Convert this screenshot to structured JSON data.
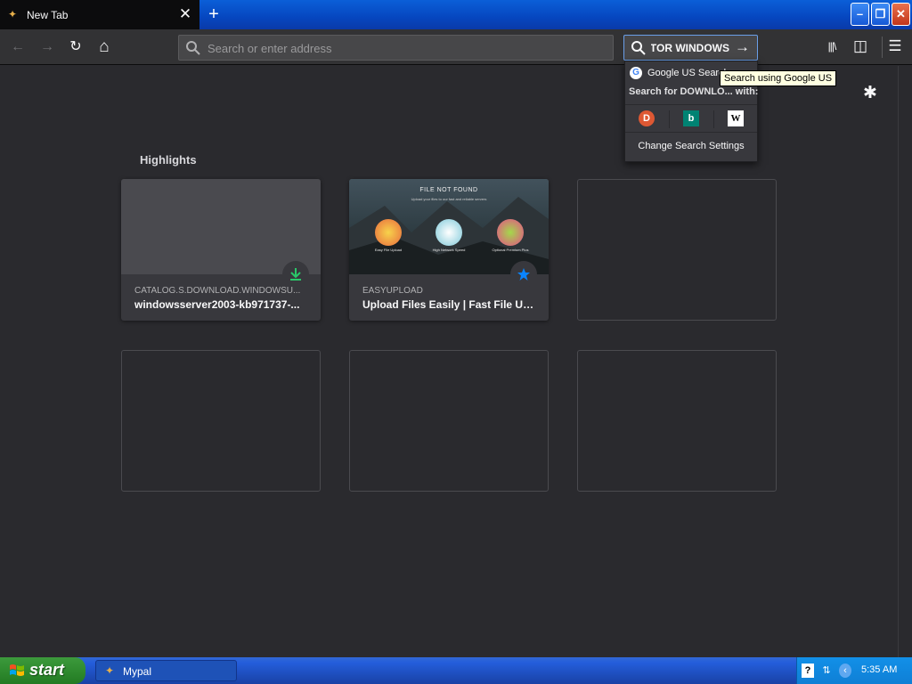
{
  "window": {
    "tab_title": "New Tab",
    "tab_close": "✕",
    "new_tab": "+",
    "minimize": "–",
    "maximize": "❐",
    "close": "✕"
  },
  "navbar": {
    "back": "←",
    "forward": "→",
    "reload": "↻",
    "home": "⌂",
    "url_placeholder": "Search or enter address",
    "search_value": "TOR WINDOWS",
    "search_go": "→",
    "library": "|||\\",
    "sidebar": "◫",
    "menu": "☰"
  },
  "content": {
    "settings_icon": "✱",
    "section_title": "Highlights",
    "highlights": [
      {
        "host": "CATALOG.S.DOWNLOAD.WINDOWSU...",
        "title": "windowsserver2003-kb971737-...",
        "badge": "download-icon"
      },
      {
        "host": "EASYUPLOAD",
        "title": "Upload Files Easily | Fast File Upl...",
        "badge": "bookmark-star-icon"
      }
    ],
    "thumbnail": {
      "heading": "FILE NOT FOUND",
      "sub": "Upload your files to our fast and reliable servers",
      "features": [
        "Easy File Upload",
        "High Network Speed",
        "Optional Premium Plus"
      ]
    }
  },
  "search_popup": {
    "engine_name": "Google US Search",
    "search_for": "Search for DOWNLO...  with:",
    "engines": [
      "duckduckgo-icon",
      "bing-icon",
      "wikipedia-icon"
    ],
    "settings_label": "Change Search Settings",
    "tooltip": "Search using Google US"
  },
  "taskbar": {
    "start_label": "start",
    "task_label": "Mypal",
    "clock": "5:35 AM"
  },
  "colors": {
    "background": "#2a2a2e",
    "toolbar": "#323234",
    "xp_blue": "#245edb",
    "start_green": "#2f8b2f"
  }
}
